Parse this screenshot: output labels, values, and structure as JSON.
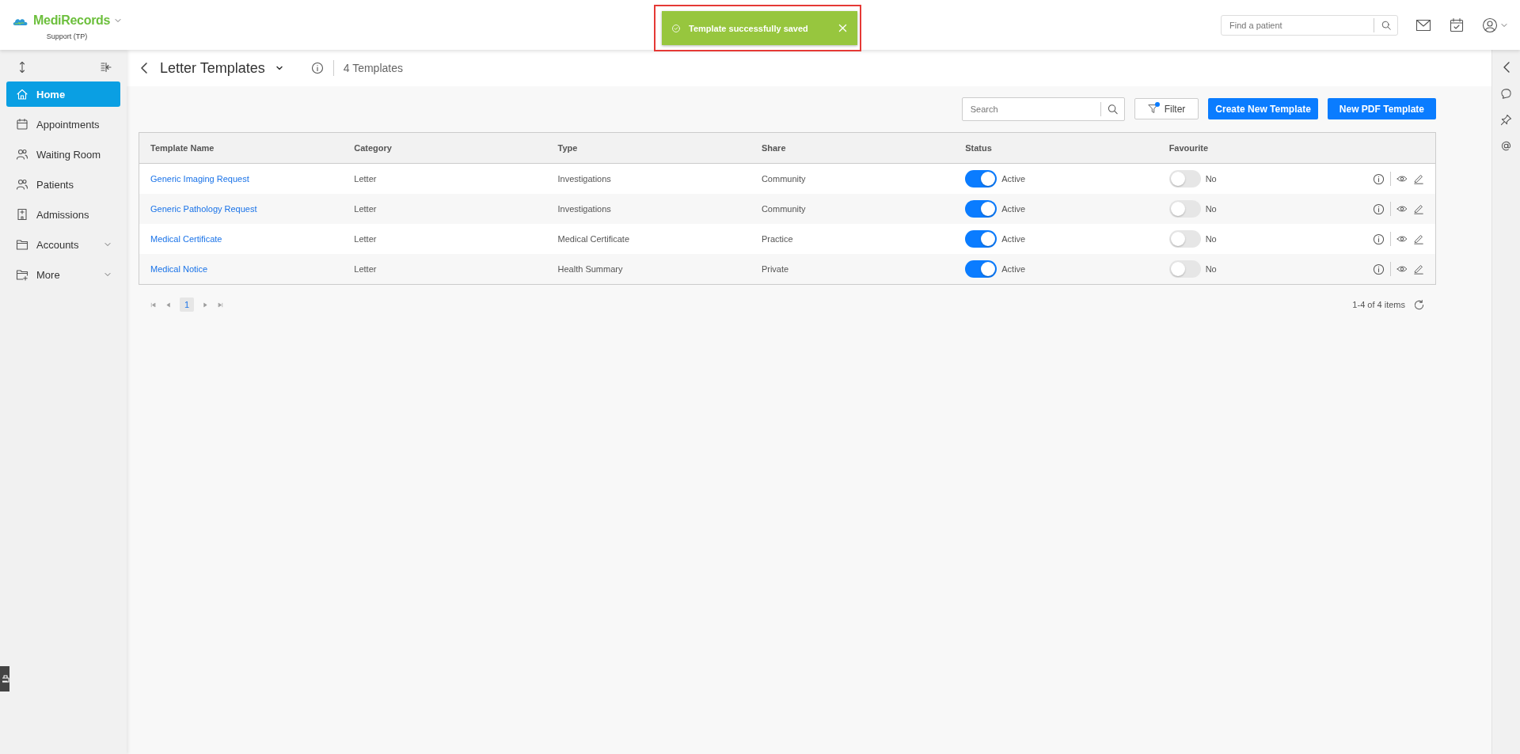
{
  "header": {
    "brand": "MediRecords",
    "practice": "Support (TP)",
    "patient_search": {
      "placeholder": "Find a patient"
    }
  },
  "toast": {
    "message": "Template successfully saved",
    "highlighted": true
  },
  "sidebar": {
    "items": [
      {
        "label": "Home",
        "kind": "home",
        "selected": true,
        "expandable": false
      },
      {
        "label": "Appointments",
        "kind": "calendar",
        "selected": false,
        "expandable": false
      },
      {
        "label": "Waiting Room",
        "kind": "people",
        "selected": false,
        "expandable": false
      },
      {
        "label": "Patients",
        "kind": "people",
        "selected": false,
        "expandable": false
      },
      {
        "label": "Admissions",
        "kind": "building",
        "selected": false,
        "expandable": false
      },
      {
        "label": "Accounts",
        "kind": "folder",
        "selected": false,
        "expandable": true
      },
      {
        "label": "More",
        "kind": "folder-plus",
        "selected": false,
        "expandable": true
      }
    ]
  },
  "page": {
    "title": "Letter Templates",
    "count": "4 Templates"
  },
  "toolbar": {
    "search": {
      "placeholder": "Search"
    },
    "filter": {
      "label": "Filter",
      "active": true
    },
    "buttons": [
      "Create New Template",
      "New PDF Template"
    ]
  },
  "table": {
    "columns": [
      "Template Name",
      "Category",
      "Type",
      "Share",
      "Status",
      "Favourite"
    ],
    "rows": [
      {
        "template_name": "Generic Imaging Request",
        "category": "Letter",
        "type": "Investigations",
        "share": "Community",
        "status_on": true,
        "status": "Active",
        "favourite_on": false,
        "favourite": "No"
      },
      {
        "template_name": "Generic Pathology Request",
        "category": "Letter",
        "type": "Investigations",
        "share": "Community",
        "status_on": true,
        "status": "Active",
        "favourite_on": false,
        "favourite": "No"
      },
      {
        "template_name": "Medical Certificate",
        "category": "Letter",
        "type": "Medical Certificate",
        "share": "Practice",
        "status_on": true,
        "status": "Active",
        "favourite_on": false,
        "favourite": "No"
      },
      {
        "template_name": "Medical Notice",
        "category": "Letter",
        "type": "Health Summary",
        "share": "Private",
        "status_on": true,
        "status": "Active",
        "favourite_on": false,
        "favourite": "No"
      }
    ]
  },
  "pagination": {
    "pages": [
      {
        "label": "1",
        "selected": true
      }
    ],
    "summary": "1-4 of 4 items"
  }
}
